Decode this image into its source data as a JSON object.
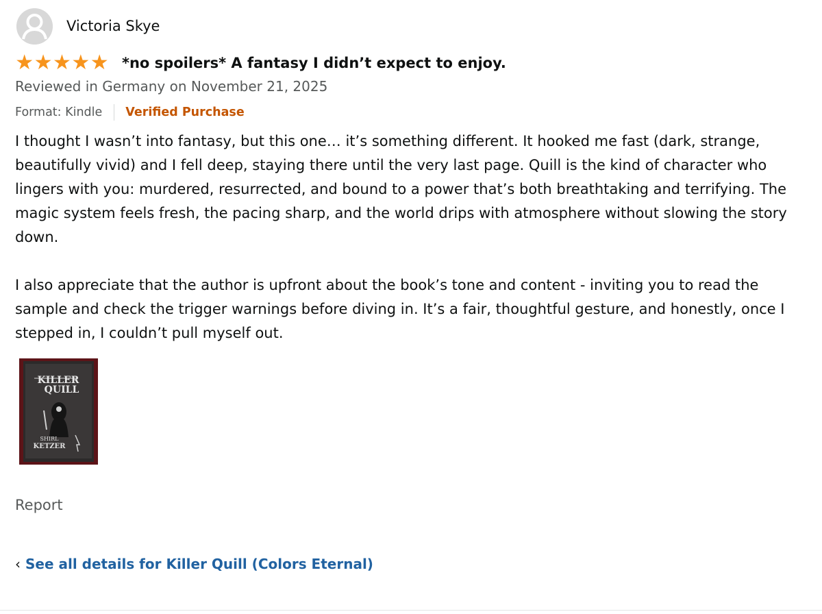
{
  "reviewer": {
    "name": "Victoria Skye",
    "avatar_icon": "default-user-avatar-icon"
  },
  "review": {
    "rating": 5,
    "rating_max": 5,
    "star_color": "#f7941d",
    "title": "*no spoilers* A fantasy I didn’t expect to enjoy.",
    "date": "Reviewed in Germany on November 21, 2025",
    "format": "Format: Kindle",
    "verified": "Verified Purchase",
    "paragraphs": [
      "I thought I wasn’t into fantasy, but this one… it’s something different. It hooked me fast (dark, strange, beautifully vivid) and I fell deep, staying there until the very last page. Quill is the kind of character who lingers with you: murdered, resurrected, and bound to a power that’s both breathtaking and terrifying. The magic system feels fresh, the pacing sharp, and the world drips with atmosphere without slowing the story down.",
      "I also appreciate that the author is upfront about the book’s tone and content - inviting you to read the sample and check the trigger warnings before diving in. It’s a fair, thoughtful gesture, and honestly, once I stepped in, I couldn’t pull myself out."
    ],
    "image": {
      "cover_title_line1": "KILLER",
      "cover_title_line2": "QUILL",
      "cover_author_line1": "SHIRL",
      "cover_author_line2": "KETZER"
    }
  },
  "actions": {
    "report": "Report",
    "see_all_chevron": "‹",
    "see_all": "See all details for Killer Quill (Colors Eternal)"
  },
  "colors": {
    "link_blue": "#2162a1",
    "verified_orange": "#c45500",
    "secondary_gray": "#565959"
  }
}
